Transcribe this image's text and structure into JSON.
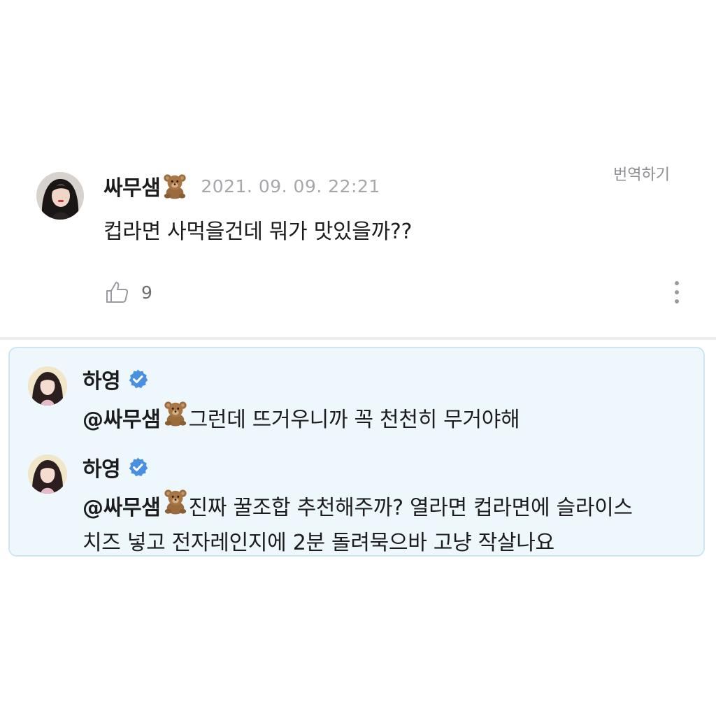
{
  "post": {
    "author": "싸무샘",
    "author_emoji": "teddy-bear-icon",
    "timestamp": "2021. 09. 09. 22:21",
    "translate_label": "번역하기",
    "body": "컵라면 사먹을건데 뭐가 맛있을까??",
    "like_count": "9"
  },
  "replies": [
    {
      "author": "하영",
      "verified": true,
      "mention": "@싸무샘",
      "text": "그런데 뜨거우니까 꼭 천천히 무거야해",
      "text_line2": ""
    },
    {
      "author": "하영",
      "verified": true,
      "mention": "@싸무샘",
      "text": "진짜 꿀조합 추천해주까? 열라면 컵라면에 슬라이스",
      "text_line2": "치즈 넣고 전자레인지에 2분 돌려묵으바 고냥 작살나요"
    }
  ],
  "colors": {
    "reply_background": "#eef8fc",
    "reply_border": "#cfe6f0",
    "verified_blue": "#4a90e2",
    "timestamp_gray": "#a7a7ab"
  }
}
